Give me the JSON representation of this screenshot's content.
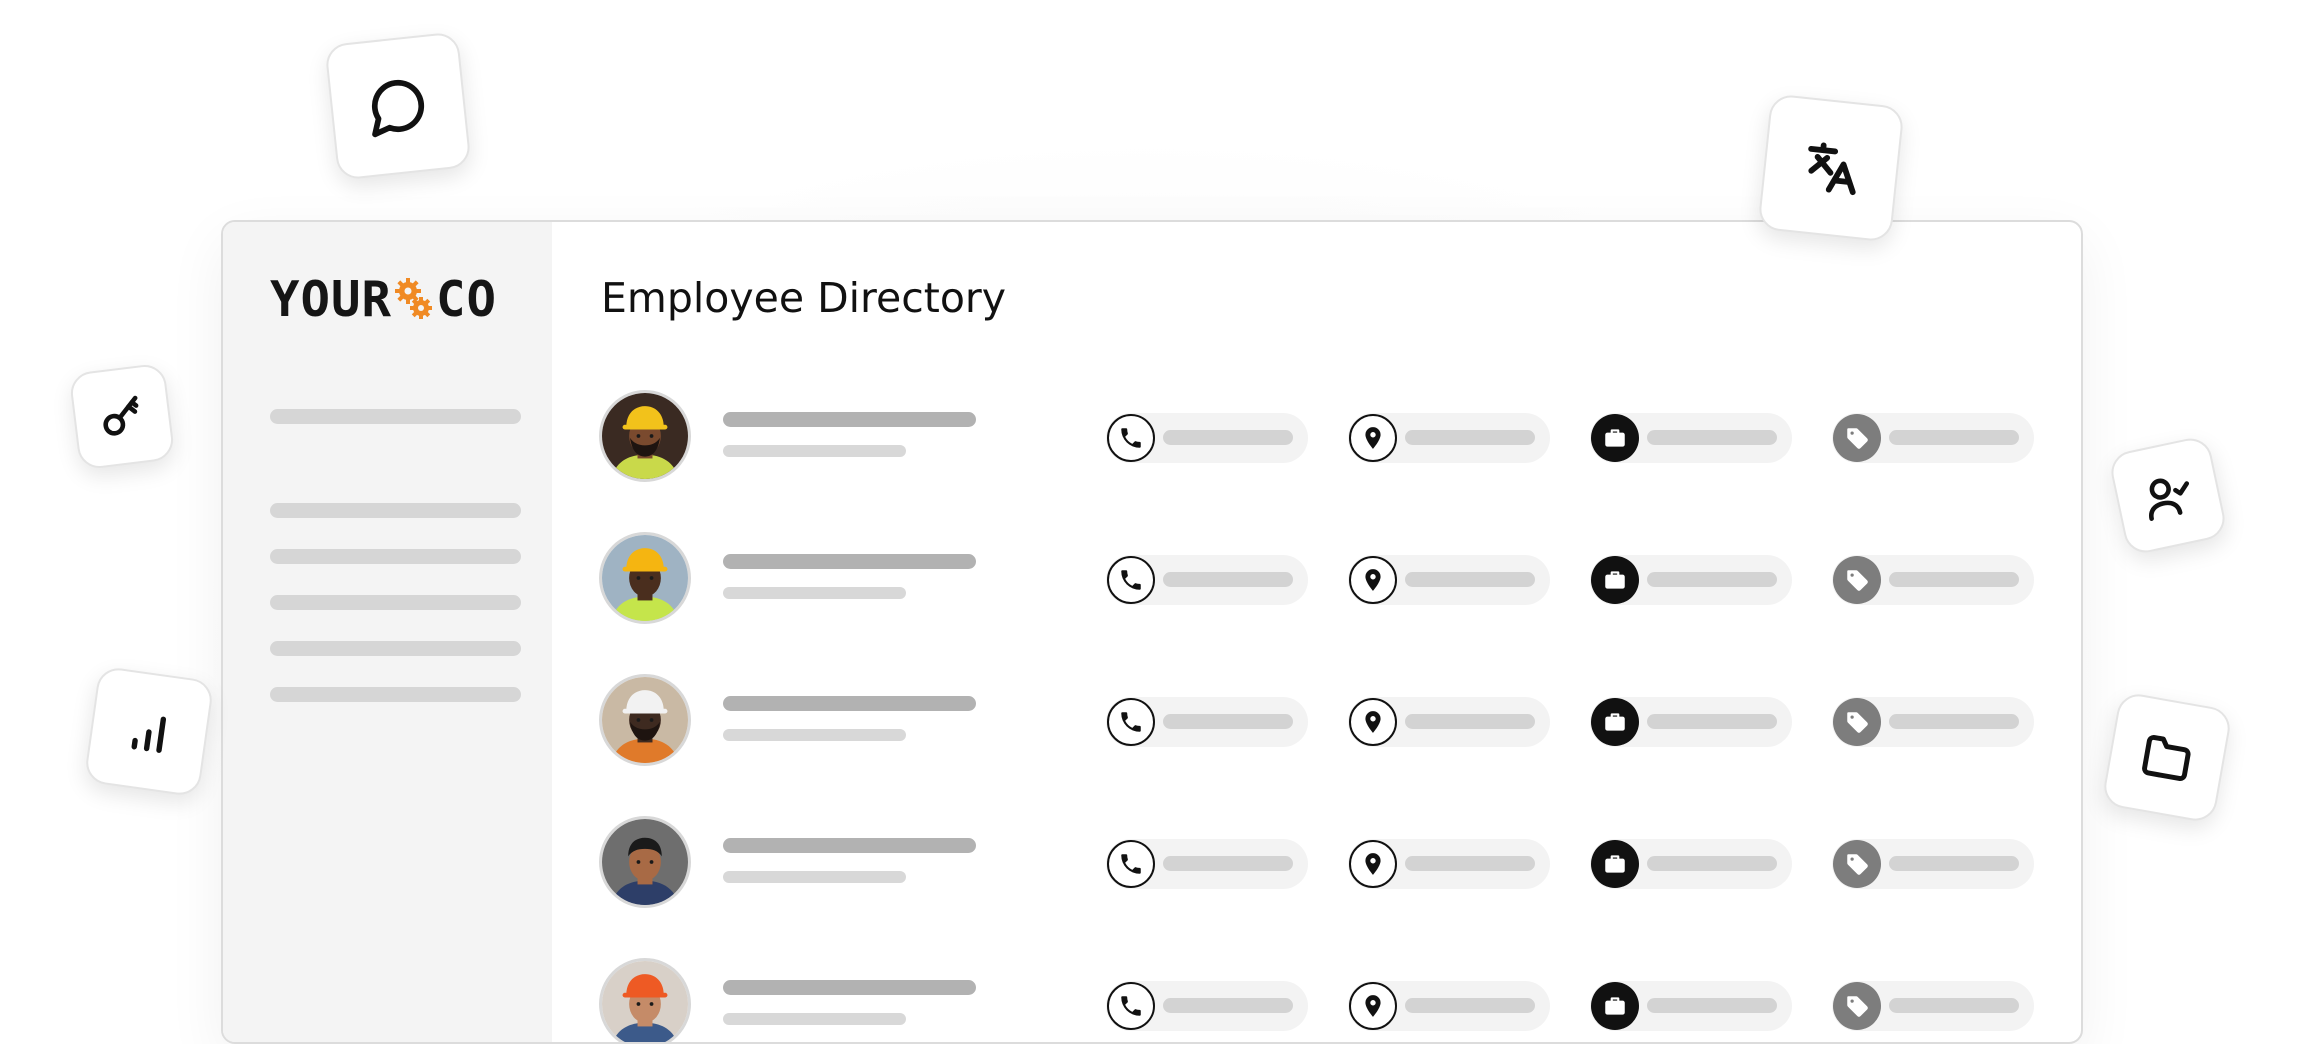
{
  "app": {
    "logo_text_left": "YOUR",
    "logo_text_right": "CO",
    "page_title": "Employee Directory"
  },
  "colors": {
    "accent_orange": "#f08a24",
    "text_dark": "#111111",
    "sidebar_bg": "#f4f4f4",
    "placeholder_bar": "#d6d6d6",
    "name_bar": "#b2b2b2"
  },
  "floating_icons": [
    "chat-bubble-icon",
    "translate-icon",
    "key-icon",
    "user-check-icon",
    "bar-chart-icon",
    "folder-icon"
  ],
  "sidebar": {
    "item_count_shown": 6
  },
  "employees": [
    {
      "avatar": "worker-yellow-hardhat-bearded",
      "fields": [
        "phone-icon",
        "location-pin-icon",
        "briefcase-icon",
        "tag-icon"
      ]
    },
    {
      "avatar": "worker-yellow-hardhat-vest",
      "fields": [
        "phone-icon",
        "location-pin-icon",
        "briefcase-icon",
        "tag-icon"
      ]
    },
    {
      "avatar": "worker-white-hardhat-goggles",
      "fields": [
        "phone-icon",
        "location-pin-icon",
        "briefcase-icon",
        "tag-icon"
      ]
    },
    {
      "avatar": "man-smiling",
      "fields": [
        "phone-icon",
        "location-pin-icon",
        "briefcase-icon",
        "tag-icon"
      ]
    },
    {
      "avatar": "worker-orange-hardhat",
      "fields": [
        "phone-icon",
        "location-pin-icon",
        "briefcase-icon",
        "tag-icon"
      ]
    }
  ]
}
